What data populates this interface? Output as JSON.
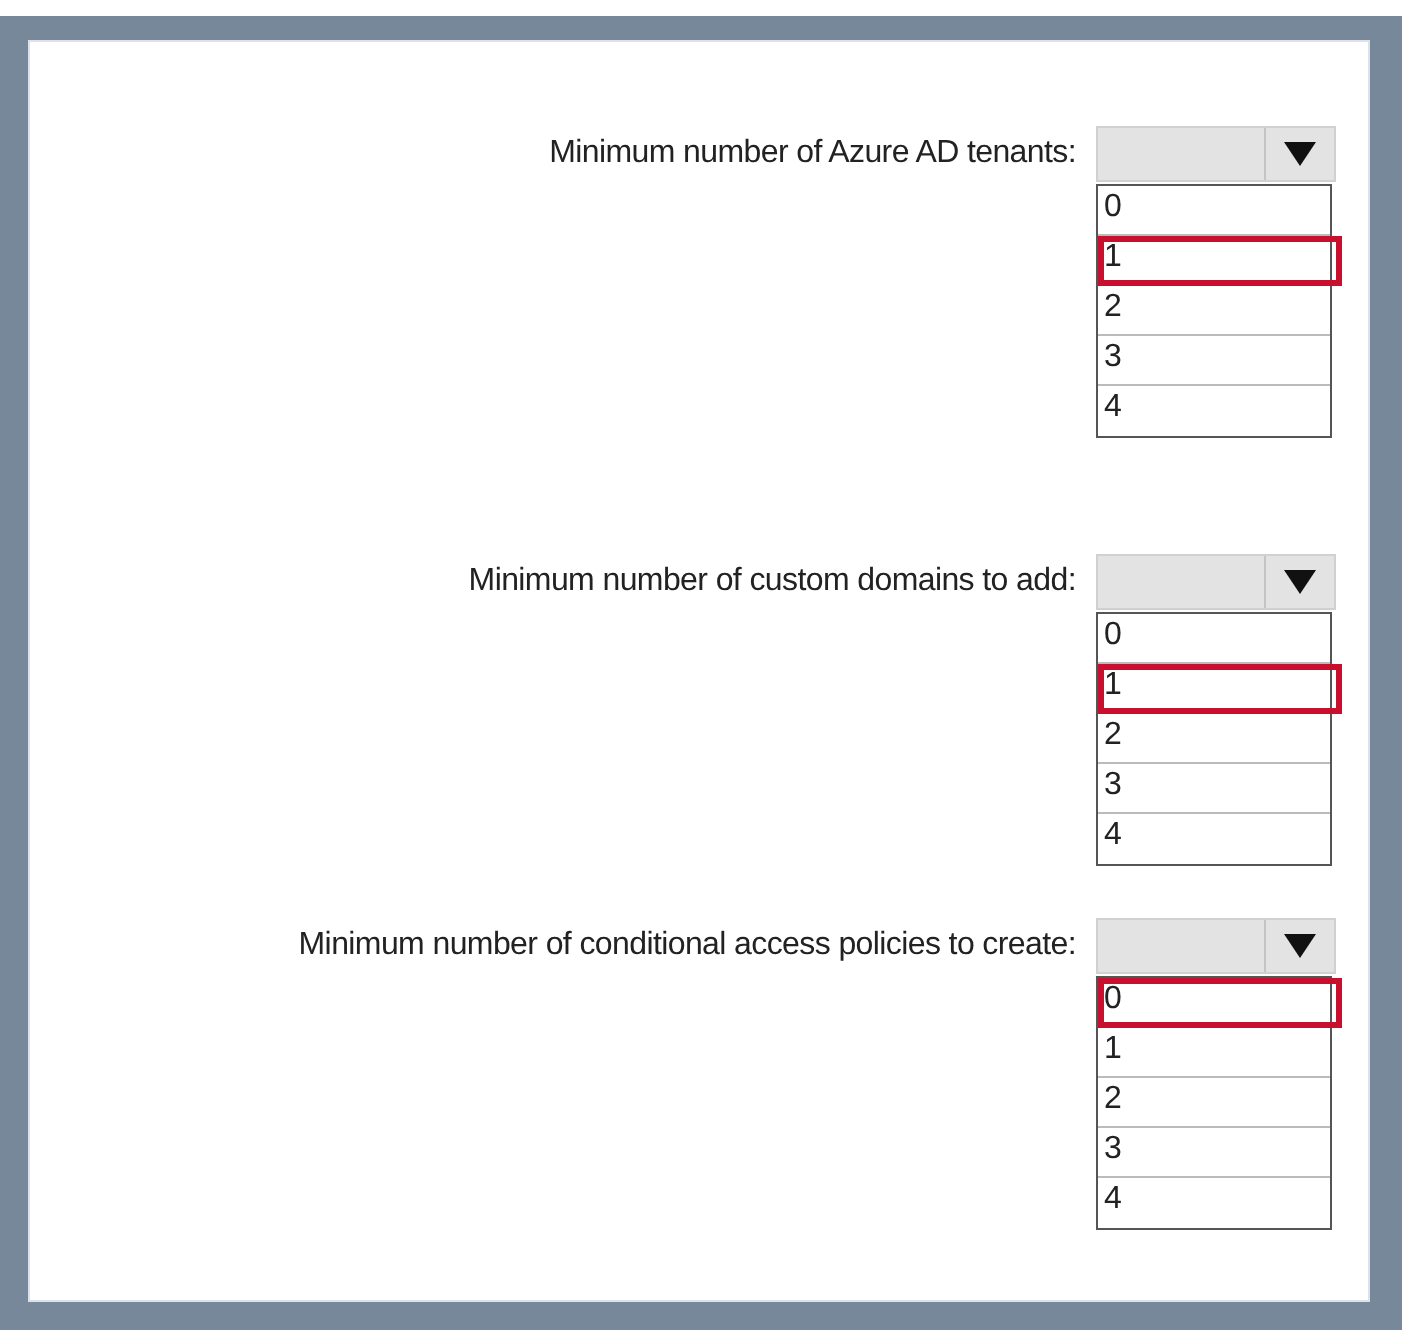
{
  "questions": [
    {
      "label": "Minimum number of Azure AD tenants:",
      "options": [
        {
          "label": "0",
          "selected": false
        },
        {
          "label": "1",
          "selected": true
        },
        {
          "label": "2",
          "selected": false
        },
        {
          "label": "3",
          "selected": false
        },
        {
          "label": "4",
          "selected": false
        }
      ]
    },
    {
      "label": "Minimum number of custom domains to add:",
      "options": [
        {
          "label": "0",
          "selected": false
        },
        {
          "label": "1",
          "selected": true
        },
        {
          "label": "2",
          "selected": false
        },
        {
          "label": "3",
          "selected": false
        },
        {
          "label": "4",
          "selected": false
        }
      ]
    },
    {
      "label": "Minimum number of conditional access policies to create:",
      "options": [
        {
          "label": "0",
          "selected": true
        },
        {
          "label": "1",
          "selected": false
        },
        {
          "label": "2",
          "selected": false
        },
        {
          "label": "3",
          "selected": false
        },
        {
          "label": "4",
          "selected": false
        }
      ]
    }
  ]
}
